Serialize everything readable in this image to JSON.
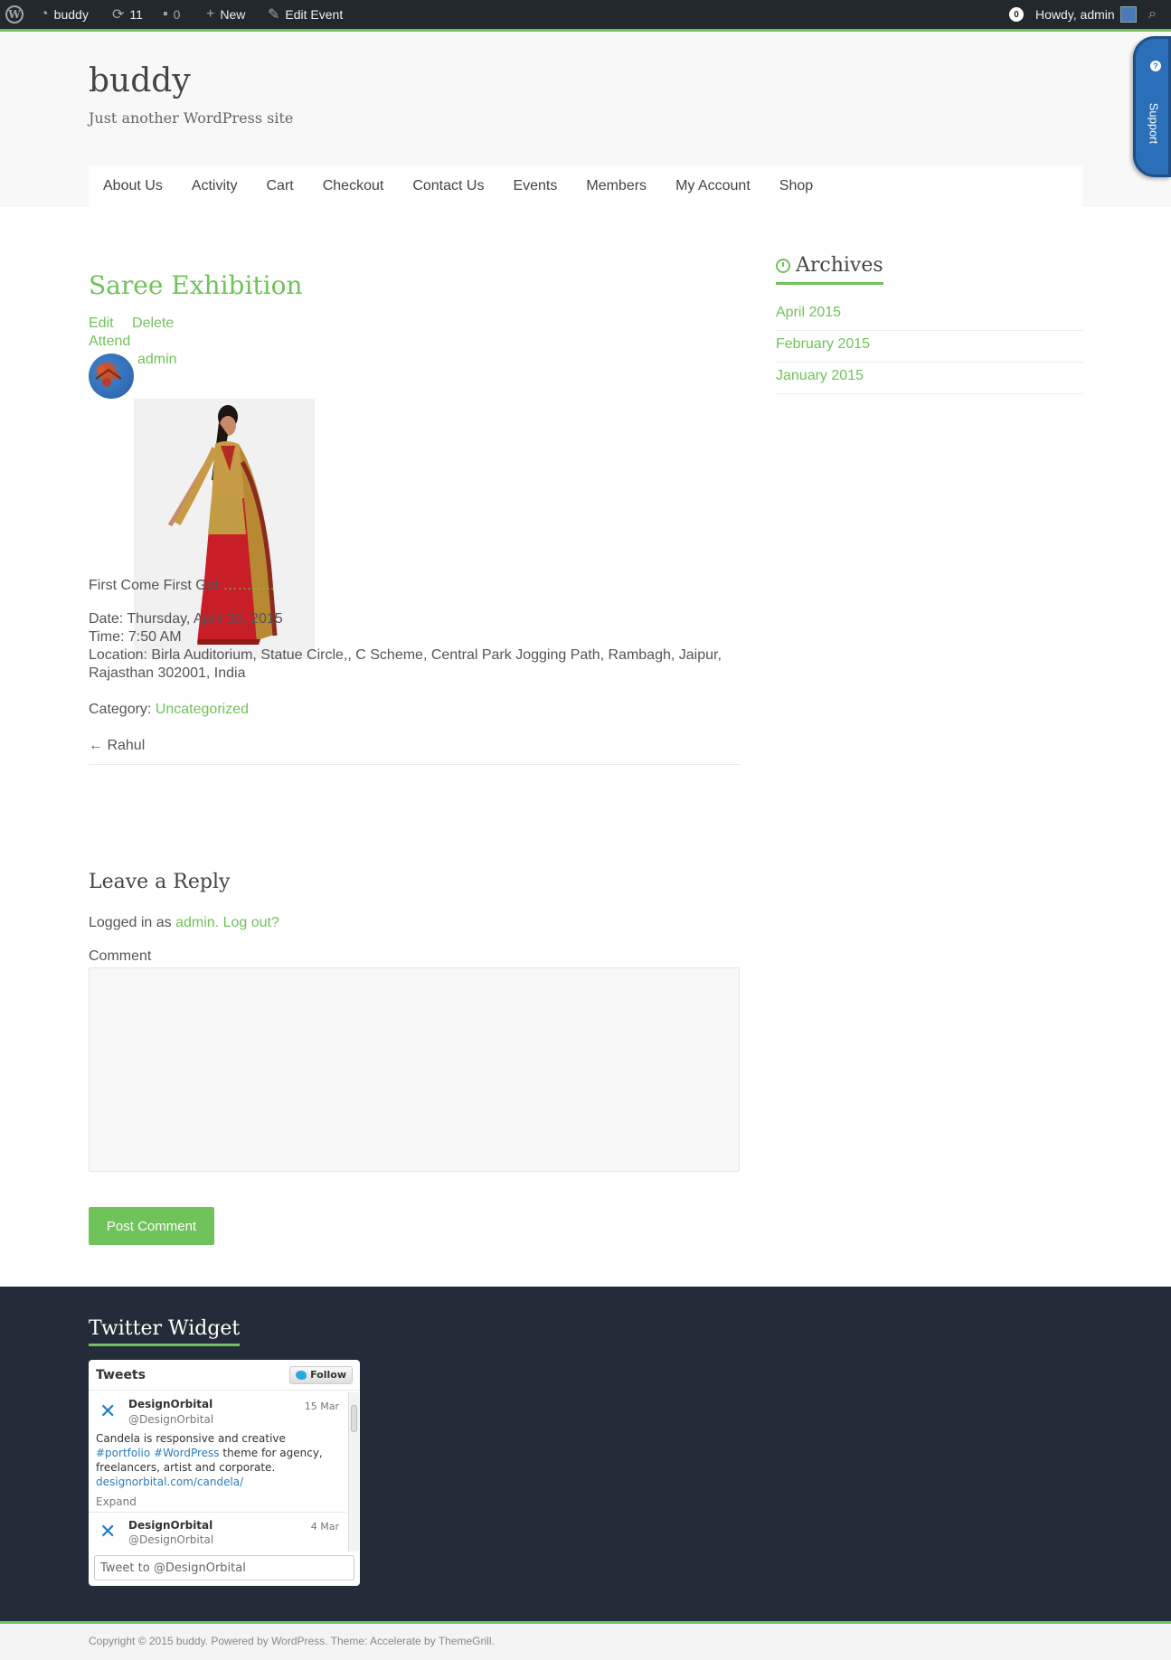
{
  "adminbar": {
    "site_name": "buddy",
    "updates_count": "11",
    "comments_count": "0",
    "new_label": "New",
    "edit_label": "Edit Event",
    "notifications": "0",
    "howdy": "Howdy, admin"
  },
  "site": {
    "title": "buddy",
    "description": "Just another WordPress site",
    "support_label": "Support"
  },
  "nav": {
    "items": [
      "About Us",
      "Activity",
      "Cart",
      "Checkout",
      "Contact Us",
      "Events",
      "Members",
      "My Account",
      "Shop"
    ]
  },
  "post": {
    "title": "Saree Exhibition",
    "edit_label": "Edit",
    "delete_label": "Delete",
    "attend_label": "Attend",
    "author": "admin",
    "excerpt_prefix": "First Come First Get",
    "excerpt_dots": "………..",
    "date": "Date: Thursday, April 30, 2015",
    "time": "Time: 7:50 AM",
    "location_1": "Location: Birla Auditorium, Statue Circle,, C Scheme, Central Park Jogging Path, Rambagh, Jaipur,",
    "location_2": "Rajasthan 302001, India",
    "category_label": "Category:",
    "category": "Uncategorized",
    "prev_link": "← Rahul"
  },
  "reply": {
    "title": "Leave a Reply",
    "logged_prefix": "Logged in as",
    "logged_user": "admin",
    "logout": "Log out?",
    "comment_label": "Comment",
    "button": "Post Comment"
  },
  "sidebar": {
    "archives_title": "Archives",
    "archives": [
      "April 2015",
      "February 2015",
      "January 2015"
    ]
  },
  "twitter": {
    "widget_title": "Twitter Widget",
    "header": "Tweets",
    "follow": "Follow",
    "tweets": [
      {
        "name": "DesignOrbital",
        "handle": "@DesignOrbital",
        "date": "15 Mar",
        "text_1": "Candela is responsive and creative",
        "tag_1": "#portfolio",
        "tag_2": "#WordPress",
        "text_2": "theme for agency,",
        "text_3": "freelancers, artist and corporate.",
        "link": "designorbital.com/candela/",
        "expand": "Expand"
      },
      {
        "name": "DesignOrbital",
        "handle": "@DesignOrbital",
        "date": "4 Mar"
      }
    ],
    "tweet_to": "Tweet to @DesignOrbital"
  },
  "footer": {
    "copyright": "Copyright © 2015 buddy. Powered by WordPress. Theme: Accelerate by ThemeGrill."
  }
}
